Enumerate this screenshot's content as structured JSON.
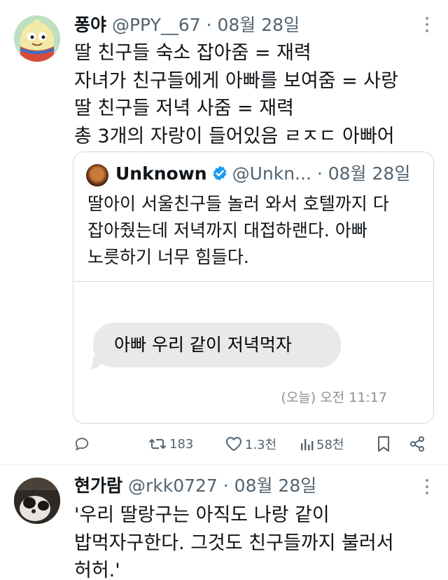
{
  "tweet1": {
    "name": "퐁야",
    "handle": "@PPY__67",
    "separator": " · ",
    "date": "08월 28일",
    "lines": [
      "딸 친구들 숙소 잡아줌 = 재력",
      "자녀가 친구들에게 아빠를 보여줌 = 사랑",
      "딸 친구들 저녁 사줌 = 재력",
      "총 3개의 자랑이 들어있음 ㄹㅈㄷ 아빠어"
    ],
    "quote": {
      "name": "Unknown",
      "handle": "@Unkn...",
      "separator": " · ",
      "date": "08월 28일",
      "lines": [
        "딸아이 서울친구들 놀러 와서 호텔까지 다",
        "잡아줬는데 저녁까지 대접하랜다. 아빠",
        "노릇하기 너무 힘들다."
      ],
      "bubble": "아빠 우리 같이 저녁먹자",
      "timestamp": "(오늘) 오전 11:17"
    },
    "actions": {
      "retweets": "183",
      "likes": "1.3천",
      "views": "58천"
    }
  },
  "tweet2": {
    "name": "현가람",
    "handle": "@rkk0727",
    "separator": " · ",
    "date": "08월 28일",
    "lines": [
      "'우리 딸랑구는 아직도 나랑 같이",
      "밥먹자구한다. 그것도 친구들까지 불러서",
      "허허.'"
    ]
  },
  "colors": {
    "text": "#0f1419",
    "secondary": "#536471",
    "border": "#cfd9de",
    "verified": "#1d9bf0",
    "bubble": "#e9e9eb"
  },
  "icons": [
    "more-icon",
    "verified-icon",
    "reply-icon",
    "retweet-icon",
    "like-icon",
    "views-icon",
    "bookmark-icon",
    "share-icon"
  ]
}
